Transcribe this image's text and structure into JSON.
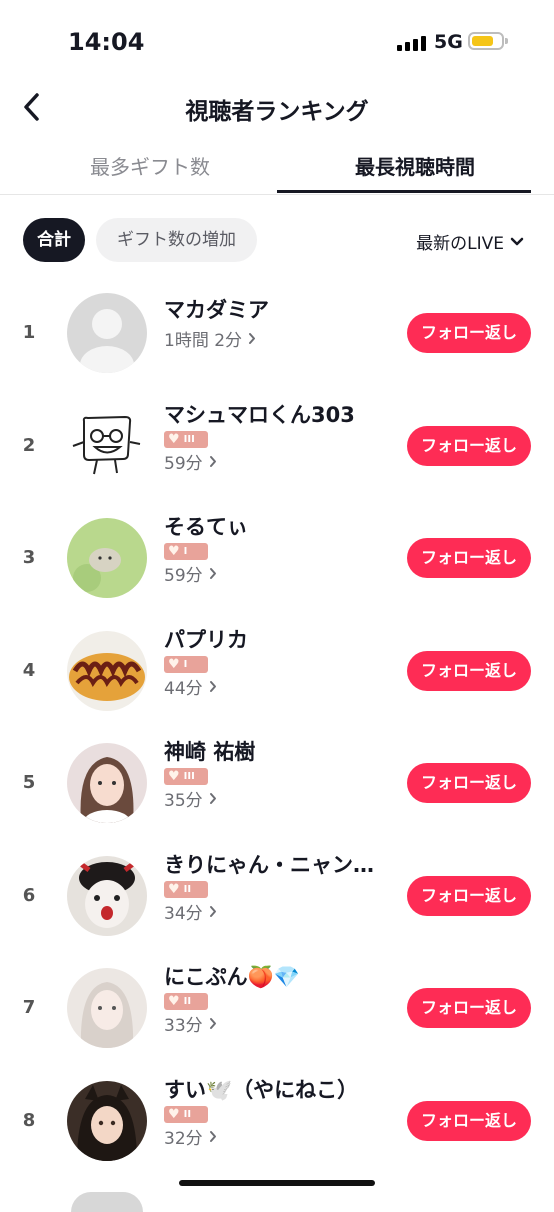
{
  "status_bar": {
    "time": "14:04",
    "network": "5G"
  },
  "header": {
    "title": "視聴者ランキング"
  },
  "tabs": [
    {
      "label": "最多ギフト数",
      "active": false
    },
    {
      "label": "最長視聴時間",
      "active": true
    }
  ],
  "filters": {
    "chips": [
      {
        "label": "合計",
        "selected": true
      },
      {
        "label": "ギフト数の増加",
        "selected": false
      }
    ],
    "sort_label": "最新のLIVE"
  },
  "follow_label": "フォロー返し",
  "viewers": [
    {
      "rank": "1",
      "name": "マカダミア",
      "duration": "1時間 2分",
      "badge_level": ""
    },
    {
      "rank": "2",
      "name": "マシュマロくん303",
      "duration": "59分",
      "badge_level": "III"
    },
    {
      "rank": "3",
      "name": "そるてぃ",
      "duration": "59分",
      "badge_level": "I"
    },
    {
      "rank": "4",
      "name": "パプリカ",
      "duration": "44分",
      "badge_level": "I"
    },
    {
      "rank": "5",
      "name": "神崎 祐樹",
      "duration": "35分",
      "badge_level": "III"
    },
    {
      "rank": "6",
      "name": "きりにゃん・ニャン…",
      "duration": "34分",
      "badge_level": "II"
    },
    {
      "rank": "7",
      "name": "にこぷん🍑💎",
      "duration": "33分",
      "badge_level": "II"
    },
    {
      "rank": "8",
      "name": "すい🕊️（やにねこ）",
      "duration": "32分",
      "badge_level": "II"
    }
  ],
  "colors": {
    "accent": "#fe2c55",
    "badge": "#e8a39a",
    "text": "#161823",
    "muted": "#8a8b91"
  }
}
